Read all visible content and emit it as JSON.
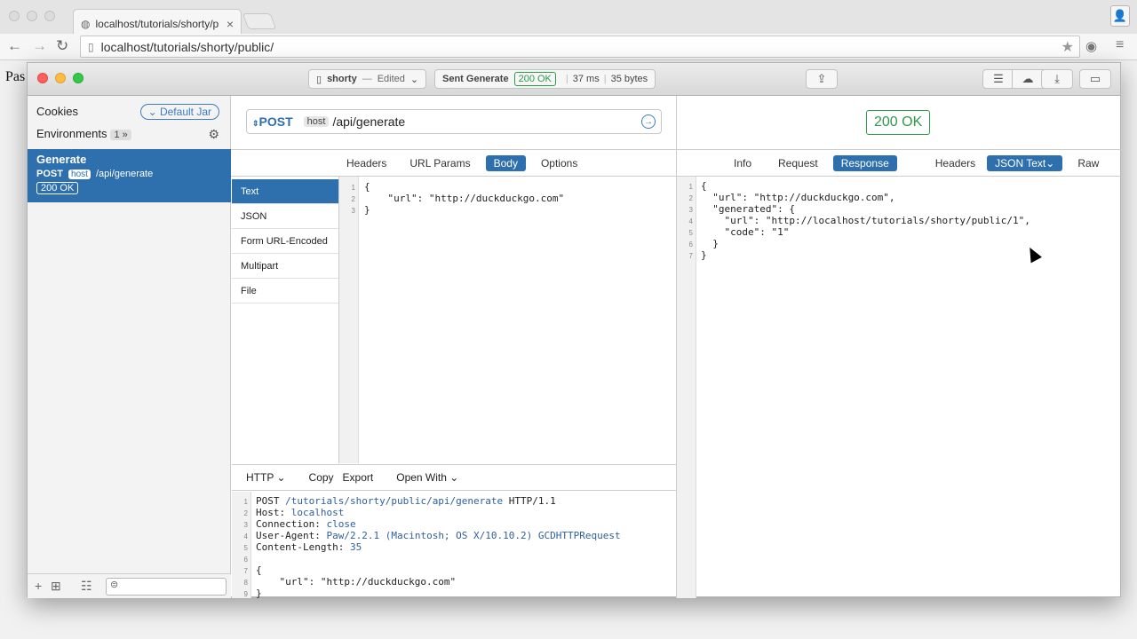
{
  "browser": {
    "tab_title": "localhost/tutorials/shorty/p",
    "url": "localhost/tutorials/shorty/public/",
    "page_peek": "Pas"
  },
  "app": {
    "document": "shorty",
    "document_state": "Edited",
    "sent_label": "Sent Generate",
    "status_badge": "200 OK",
    "time": "37 ms",
    "size": "35 bytes"
  },
  "sidebar": {
    "cookies": "Cookies",
    "jar": "Default Jar",
    "environments": "Environments",
    "env_count": "1 »",
    "request": {
      "name": "Generate",
      "method": "POST",
      "host": "host",
      "path": "/api/generate",
      "status": "200 OK"
    }
  },
  "request": {
    "method": "POST",
    "host": "host",
    "path": "/api/generate",
    "tabs": [
      "Headers",
      "URL Params",
      "Body",
      "Options"
    ],
    "active_tab": "Body",
    "body_types": [
      "Text",
      "JSON",
      "Form URL-Encoded",
      "Multipart",
      "File"
    ],
    "body_lines": [
      "{",
      "    \"url\": \"http://duckduckgo.com\"",
      "}"
    ]
  },
  "raw": {
    "format": "HTTP",
    "copy": "Copy",
    "export": "Export",
    "open_with": "Open With",
    "line1_method": "POST",
    "line1_path": "/tutorials/shorty/public/api/generate",
    "line1_proto": "HTTP/1.1",
    "host_key": "Host:",
    "host_val": "localhost",
    "conn_key": "Connection:",
    "conn_val": "close",
    "ua_key": "User-Agent:",
    "ua_val": "Paw/2.2.1 (Macintosh; OS X/10.10.2) GCDHTTPRequest",
    "cl_key": "Content-Length:",
    "cl_val": "35",
    "body_open": "{",
    "body_url": "    \"url\": \"http://duckduckgo.com\"",
    "body_close": "}"
  },
  "response": {
    "status": "200 OK",
    "tabs": [
      "Info",
      "Request",
      "Response",
      "Headers",
      "JSON Text",
      "Raw"
    ],
    "active_tab": "Response",
    "lines": [
      "{",
      "  \"url\": \"http://duckduckgo.com\",",
      "  \"generated\": {",
      "    \"url\": \"http://localhost/tutorials/shorty/public/1\",",
      "    \"code\": \"1\"",
      "  }",
      "}"
    ]
  }
}
